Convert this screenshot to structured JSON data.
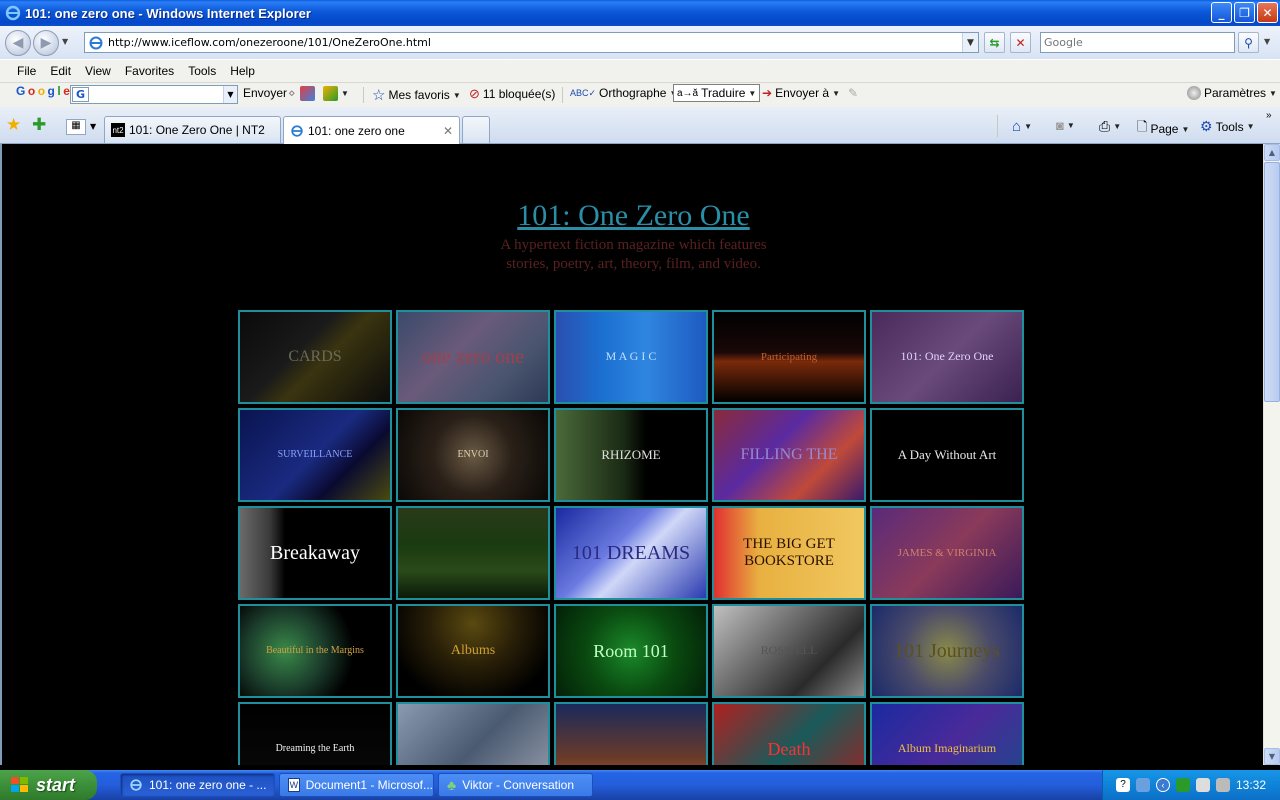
{
  "window": {
    "title": "101: one zero one - Windows Internet Explorer",
    "buttons": {
      "minimize": "_",
      "maximize": "❐",
      "close": "✕"
    }
  },
  "address": {
    "url": "http://www.iceflow.com/onezeroone/101/OneZeroOne.html",
    "search_placeholder": "Google"
  },
  "menu": [
    "File",
    "Edit",
    "View",
    "Favorites",
    "Tools",
    "Help"
  ],
  "google_toolbar": {
    "logo": "Google",
    "envoyer": "Envoyer",
    "favoris": "Mes favoris",
    "blocked": "11 bloquée(s)",
    "orthographe": "Orthographe",
    "traduire": "Traduire",
    "envoyer_a": "Envoyer à",
    "parametres": "Paramètres"
  },
  "tabs": [
    {
      "label": "101: One Zero One | NT2",
      "active": false
    },
    {
      "label": "101: one zero one",
      "active": true
    }
  ],
  "commands": {
    "page": "Page",
    "tools": "Tools"
  },
  "page": {
    "title": "101: One Zero One",
    "subtitle_line1": "A hypertext fiction magazine which features",
    "subtitle_line2": "stories, poetry, art, theory, film, and video."
  },
  "tiles": [
    {
      "caption": "CARDS",
      "bg": "linear-gradient(135deg,#0a0a0a 0%,#1a1a1a 40%,#3a3410 55%,#0b0b0b 100%)",
      "color": "#6b6a5a",
      "size": "16px"
    },
    {
      "caption": "one zero one",
      "bg": "linear-gradient(135deg,#3a4a6a 0%,#6a5a7a 40%,#4a5570 70%,#2e3a55 100%)",
      "color": "#a0404a",
      "size": "20px"
    },
    {
      "caption": "M A G I C",
      "bg": "linear-gradient(90deg,#2a4fb0 0%,#1b6fd0 30%,#2f86e0 60%,#1e5ac0 100%)",
      "color": "#bfe0ff",
      "size": "12px"
    },
    {
      "caption": "Participating",
      "bg": "linear-gradient(180deg,#000 0%,#1a0808 45%,#7a2a0a 55%,#000 100%)",
      "color": "#c0602a",
      "size": "11px"
    },
    {
      "caption": "101: One Zero One",
      "bg": "linear-gradient(135deg,#4a2a5a 0%,#6a4a7a 50%,#3a2250 100%)",
      "color": "#e0d0ff",
      "size": "12px"
    },
    {
      "caption": "SURVEILLANCE",
      "bg": "linear-gradient(135deg,#0a1450 0%,#1a2a80 50%,#0a0a30 70%,#4a4a10 100%)",
      "color": "#8aa0ff",
      "size": "10px"
    },
    {
      "caption": "ENVOI",
      "bg": "radial-gradient(circle,#6a5a45 0%,#2a2018 45%,#0a0806 100%)",
      "color": "#e0d0b0",
      "size": "10px"
    },
    {
      "caption": "RHIZOME",
      "bg": "linear-gradient(90deg,#4a6a3a 0%,#1a2a14 45%,#000 60%,#000 100%)",
      "color": "#e0e0e0",
      "size": "13px"
    },
    {
      "caption": "FILLING THE",
      "bg": "linear-gradient(135deg,#8a2a3a 0%,#5a2aa0 40%,#c04a3a 70%,#3a1a6a 100%)",
      "color": "#9a8ad0",
      "size": "16px"
    },
    {
      "caption": "A Day Without Art",
      "bg": "#000",
      "color": "#e8e8e8",
      "size": "13px"
    },
    {
      "caption": "Breakaway",
      "bg": "linear-gradient(90deg,#6a6a6a 0%,#3a3a3a 20%,#000 30%,#000 100%)",
      "color": "#ffffff",
      "size": "20px"
    },
    {
      "caption": "",
      "bg": "linear-gradient(180deg,#2a3a1a 0%,#1a3a10 40%,#2a4a1a 70%,#0a1a08 100%)",
      "color": "#ff4080",
      "size": "10px"
    },
    {
      "caption": "101 DREAMS",
      "bg": "linear-gradient(135deg,#1a2aa0 0%,#6a7ae0 40%,#d0d8f8 55%,#2a3ab0 100%)",
      "color": "#2a2a80",
      "size": "20px"
    },
    {
      "caption": "THE BIG GET BOOKSTORE",
      "bg": "linear-gradient(90deg,#e03030 0%,#e8b040 30%,#f0c860 100%)",
      "color": "#2a1000",
      "size": "15px"
    },
    {
      "caption": "JAMES & VIRGINIA",
      "bg": "linear-gradient(135deg,#5a2a7a 0%,#8a3a5a 50%,#3a1a5a 100%)",
      "color": "#d08070",
      "size": "11px"
    },
    {
      "caption": "Beautiful in the Margins",
      "bg": "radial-gradient(circle at 30% 50%,#3a8a4a 0%,#1a3a2a 35%,#000 60%)",
      "color": "#d0a040",
      "size": "10px"
    },
    {
      "caption": "Albums",
      "bg": "radial-gradient(ellipse at 50% 20%,#5a4a10 0%,#2a2008 40%,#000 80%)",
      "color": "#d0a030",
      "size": "14px"
    },
    {
      "caption": "Room 101",
      "bg": "radial-gradient(circle,#1a8a2a 0%,#0a4a10 50%,#032008 100%)",
      "color": "#c0ffc0",
      "size": "18px"
    },
    {
      "caption": "ROSWELL",
      "bg": "linear-gradient(135deg,#c0c0c0 0%,#6a6a6a 40%,#2a2a2a 70%,#8a8a8a 100%)",
      "color": "#555",
      "size": "12px"
    },
    {
      "caption": "101 Journeys",
      "bg": "radial-gradient(circle,#8a8a4a 0%,#4a4a6a 50%,#1a2a6a 100%)",
      "color": "#5a5020",
      "size": "20px"
    },
    {
      "caption": "Dreaming the Earth",
      "bg": "linear-gradient(180deg,#000 0%,#0a0a0a 100%)",
      "color": "#f0f0f0",
      "size": "10px"
    },
    {
      "caption": "",
      "bg": "linear-gradient(135deg,#8a9ab0 0%,#4a5a70 50%,#9aa0b0 100%)",
      "color": "#fff",
      "size": "10px"
    },
    {
      "caption": "",
      "bg": "linear-gradient(180deg,#1a2a5a 0%,#6a3a2a 60%,#c0602a 100%)",
      "color": "#fff",
      "size": "10px"
    },
    {
      "caption": "Death",
      "bg": "linear-gradient(135deg,#b02020 0%,#1a5a5a 50%,#a02020 100%)",
      "color": "#ff3030",
      "size": "18px"
    },
    {
      "caption": "Album Imaginarium",
      "bg": "linear-gradient(135deg,#1a2aa0 0%,#4a2a9a 50%,#1a4a8a 100%)",
      "color": "#f0c040",
      "size": "12px"
    }
  ],
  "taskbar": {
    "start": "start",
    "tasks": [
      {
        "label": "101: one zero one - ...",
        "active": true
      },
      {
        "label": "Document1 - Microsof...",
        "active": false
      },
      {
        "label": "Viktor - Conversation",
        "active": false
      }
    ],
    "clock": "13:32"
  }
}
